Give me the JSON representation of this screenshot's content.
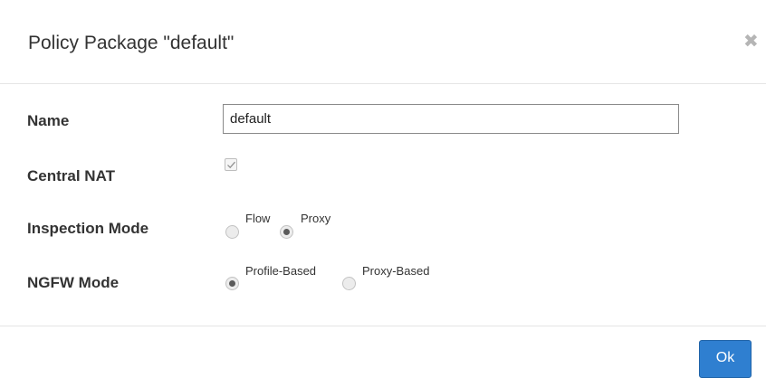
{
  "dialog": {
    "title": "Policy Package \"default\"",
    "close_icon": "close-icon"
  },
  "form": {
    "name": {
      "label": "Name",
      "value": "default"
    },
    "central_nat": {
      "label": "Central NAT",
      "checked": true
    },
    "inspection_mode": {
      "label": "Inspection Mode",
      "options": [
        {
          "label": "Flow",
          "selected": false
        },
        {
          "label": "Proxy",
          "selected": true
        }
      ]
    },
    "ngfw_mode": {
      "label": "NGFW Mode",
      "options": [
        {
          "label": "Profile-Based",
          "selected": true
        },
        {
          "label": "Proxy-Based",
          "selected": false
        }
      ]
    }
  },
  "footer": {
    "ok_label": "Ok"
  },
  "colors": {
    "primary_button": "#2f7fd0"
  }
}
